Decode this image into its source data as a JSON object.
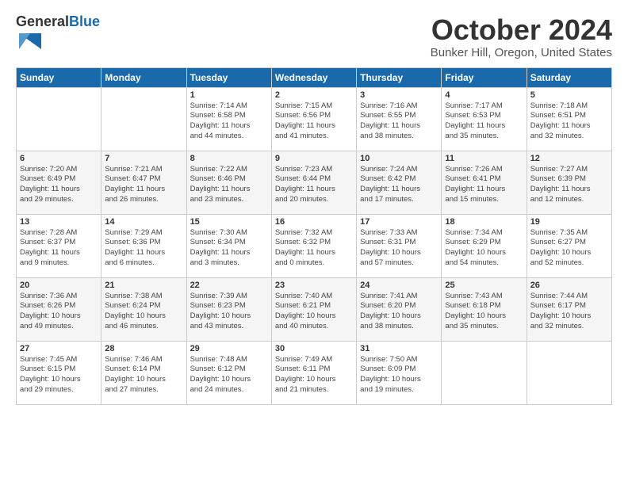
{
  "header": {
    "logo_general": "General",
    "logo_blue": "Blue",
    "month_title": "October 2024",
    "location": "Bunker Hill, Oregon, United States"
  },
  "days_of_week": [
    "Sunday",
    "Monday",
    "Tuesday",
    "Wednesday",
    "Thursday",
    "Friday",
    "Saturday"
  ],
  "weeks": [
    [
      {
        "day": "",
        "content": ""
      },
      {
        "day": "",
        "content": ""
      },
      {
        "day": "1",
        "content": "Sunrise: 7:14 AM\nSunset: 6:58 PM\nDaylight: 11 hours\nand 44 minutes."
      },
      {
        "day": "2",
        "content": "Sunrise: 7:15 AM\nSunset: 6:56 PM\nDaylight: 11 hours\nand 41 minutes."
      },
      {
        "day": "3",
        "content": "Sunrise: 7:16 AM\nSunset: 6:55 PM\nDaylight: 11 hours\nand 38 minutes."
      },
      {
        "day": "4",
        "content": "Sunrise: 7:17 AM\nSunset: 6:53 PM\nDaylight: 11 hours\nand 35 minutes."
      },
      {
        "day": "5",
        "content": "Sunrise: 7:18 AM\nSunset: 6:51 PM\nDaylight: 11 hours\nand 32 minutes."
      }
    ],
    [
      {
        "day": "6",
        "content": "Sunrise: 7:20 AM\nSunset: 6:49 PM\nDaylight: 11 hours\nand 29 minutes."
      },
      {
        "day": "7",
        "content": "Sunrise: 7:21 AM\nSunset: 6:47 PM\nDaylight: 11 hours\nand 26 minutes."
      },
      {
        "day": "8",
        "content": "Sunrise: 7:22 AM\nSunset: 6:46 PM\nDaylight: 11 hours\nand 23 minutes."
      },
      {
        "day": "9",
        "content": "Sunrise: 7:23 AM\nSunset: 6:44 PM\nDaylight: 11 hours\nand 20 minutes."
      },
      {
        "day": "10",
        "content": "Sunrise: 7:24 AM\nSunset: 6:42 PM\nDaylight: 11 hours\nand 17 minutes."
      },
      {
        "day": "11",
        "content": "Sunrise: 7:26 AM\nSunset: 6:41 PM\nDaylight: 11 hours\nand 15 minutes."
      },
      {
        "day": "12",
        "content": "Sunrise: 7:27 AM\nSunset: 6:39 PM\nDaylight: 11 hours\nand 12 minutes."
      }
    ],
    [
      {
        "day": "13",
        "content": "Sunrise: 7:28 AM\nSunset: 6:37 PM\nDaylight: 11 hours\nand 9 minutes."
      },
      {
        "day": "14",
        "content": "Sunrise: 7:29 AM\nSunset: 6:36 PM\nDaylight: 11 hours\nand 6 minutes."
      },
      {
        "day": "15",
        "content": "Sunrise: 7:30 AM\nSunset: 6:34 PM\nDaylight: 11 hours\nand 3 minutes."
      },
      {
        "day": "16",
        "content": "Sunrise: 7:32 AM\nSunset: 6:32 PM\nDaylight: 11 hours\nand 0 minutes."
      },
      {
        "day": "17",
        "content": "Sunrise: 7:33 AM\nSunset: 6:31 PM\nDaylight: 10 hours\nand 57 minutes."
      },
      {
        "day": "18",
        "content": "Sunrise: 7:34 AM\nSunset: 6:29 PM\nDaylight: 10 hours\nand 54 minutes."
      },
      {
        "day": "19",
        "content": "Sunrise: 7:35 AM\nSunset: 6:27 PM\nDaylight: 10 hours\nand 52 minutes."
      }
    ],
    [
      {
        "day": "20",
        "content": "Sunrise: 7:36 AM\nSunset: 6:26 PM\nDaylight: 10 hours\nand 49 minutes."
      },
      {
        "day": "21",
        "content": "Sunrise: 7:38 AM\nSunset: 6:24 PM\nDaylight: 10 hours\nand 46 minutes."
      },
      {
        "day": "22",
        "content": "Sunrise: 7:39 AM\nSunset: 6:23 PM\nDaylight: 10 hours\nand 43 minutes."
      },
      {
        "day": "23",
        "content": "Sunrise: 7:40 AM\nSunset: 6:21 PM\nDaylight: 10 hours\nand 40 minutes."
      },
      {
        "day": "24",
        "content": "Sunrise: 7:41 AM\nSunset: 6:20 PM\nDaylight: 10 hours\nand 38 minutes."
      },
      {
        "day": "25",
        "content": "Sunrise: 7:43 AM\nSunset: 6:18 PM\nDaylight: 10 hours\nand 35 minutes."
      },
      {
        "day": "26",
        "content": "Sunrise: 7:44 AM\nSunset: 6:17 PM\nDaylight: 10 hours\nand 32 minutes."
      }
    ],
    [
      {
        "day": "27",
        "content": "Sunrise: 7:45 AM\nSunset: 6:15 PM\nDaylight: 10 hours\nand 29 minutes."
      },
      {
        "day": "28",
        "content": "Sunrise: 7:46 AM\nSunset: 6:14 PM\nDaylight: 10 hours\nand 27 minutes."
      },
      {
        "day": "29",
        "content": "Sunrise: 7:48 AM\nSunset: 6:12 PM\nDaylight: 10 hours\nand 24 minutes."
      },
      {
        "day": "30",
        "content": "Sunrise: 7:49 AM\nSunset: 6:11 PM\nDaylight: 10 hours\nand 21 minutes."
      },
      {
        "day": "31",
        "content": "Sunrise: 7:50 AM\nSunset: 6:09 PM\nDaylight: 10 hours\nand 19 minutes."
      },
      {
        "day": "",
        "content": ""
      },
      {
        "day": "",
        "content": ""
      }
    ]
  ]
}
